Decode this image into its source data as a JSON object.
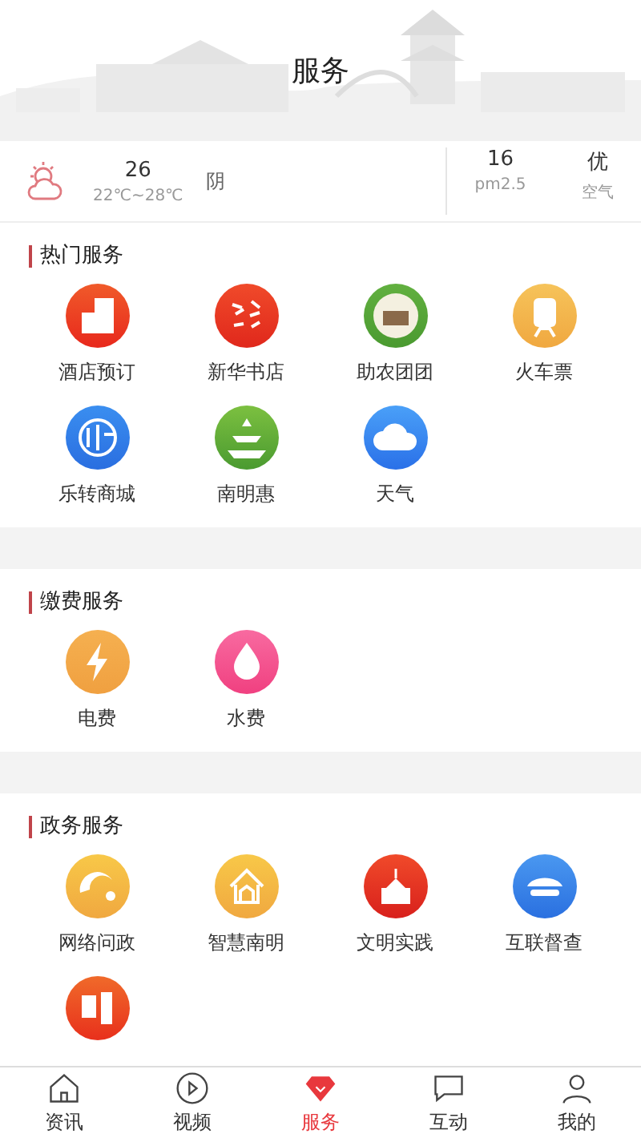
{
  "header": {
    "title": "服务"
  },
  "weather": {
    "temperature": "26",
    "range": "22℃~28℃",
    "condition": "阴",
    "pm_value": "16",
    "pm_label": "pm2.5",
    "air_value": "优",
    "air_label": "空气"
  },
  "sections": [
    {
      "title": "热门服务",
      "items": [
        {
          "label": "酒店预订",
          "kind": "hotel"
        },
        {
          "label": "新华书店",
          "kind": "bookstore"
        },
        {
          "label": "助农团团",
          "kind": "farm"
        },
        {
          "label": "火车票",
          "kind": "train"
        },
        {
          "label": "乐转商城",
          "kind": "mall"
        },
        {
          "label": "南明惠",
          "kind": "pine"
        },
        {
          "label": "天气",
          "kind": "cloud"
        }
      ]
    },
    {
      "title": "缴费服务",
      "items": [
        {
          "label": "电费",
          "kind": "power"
        },
        {
          "label": "水费",
          "kind": "water"
        }
      ]
    },
    {
      "title": "政务服务",
      "items": [
        {
          "label": "网络问政",
          "kind": "swirl"
        },
        {
          "label": "智慧南明",
          "kind": "house"
        },
        {
          "label": "文明实践",
          "kind": "flag"
        },
        {
          "label": "互联督查",
          "kind": "cap"
        },
        {
          "kind": "seal"
        }
      ]
    }
  ],
  "tabs": [
    {
      "label": "资讯",
      "kind": "home",
      "selected": false
    },
    {
      "label": "视频",
      "kind": "play",
      "selected": false
    },
    {
      "label": "服务",
      "kind": "gem",
      "selected": true
    },
    {
      "label": "互动",
      "kind": "chat",
      "selected": false
    },
    {
      "label": "我的",
      "kind": "user",
      "selected": false
    }
  ]
}
